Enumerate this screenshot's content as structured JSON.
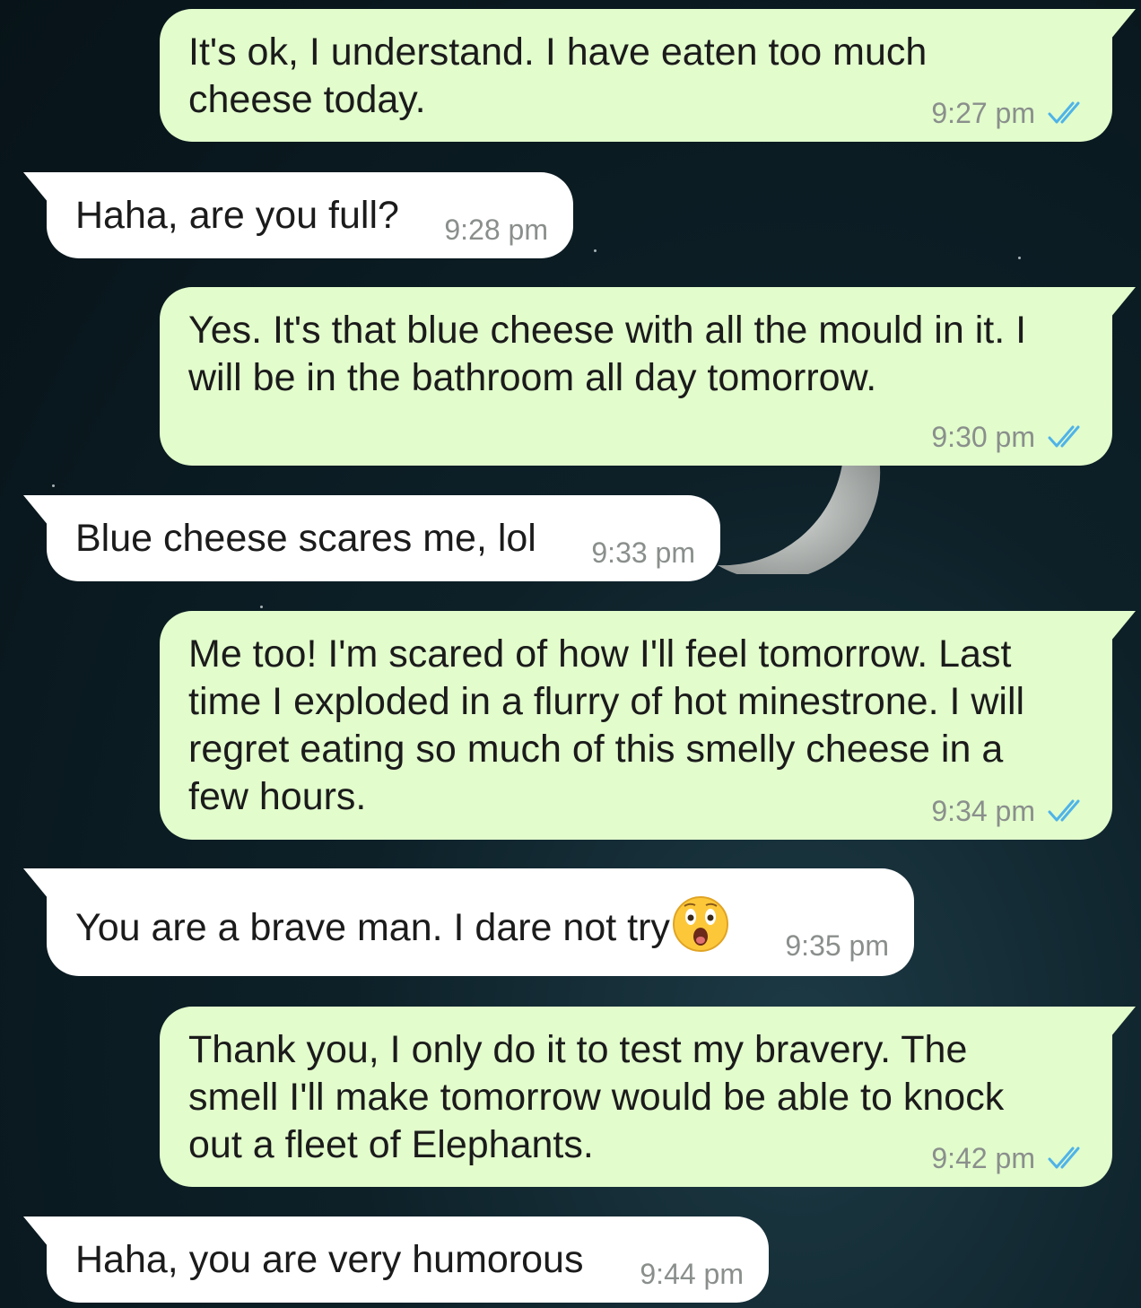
{
  "colors": {
    "outgoing_bubble": "#e2fccc",
    "incoming_bubble": "#ffffff",
    "read_receipt": "#4fb3e8",
    "timestamp": "#8a8f8c",
    "background": "#0d2028"
  },
  "messages": [
    {
      "direction": "out",
      "text": "It's ok, I understand. I have eaten too much\ncheese today.",
      "time": "9:27 pm",
      "status": "read-double-check-icon"
    },
    {
      "direction": "in",
      "text": "Haha, are you full?",
      "time": "9:28 pm"
    },
    {
      "direction": "out",
      "text": "Yes. It's that blue cheese with all the mould in it. I\nwill be in the bathroom all day tomorrow.",
      "time": "9:30 pm",
      "status": "read-double-check-icon"
    },
    {
      "direction": "in",
      "text": "Blue cheese scares me, lol",
      "time": "9:33 pm"
    },
    {
      "direction": "out",
      "text": "Me too! I'm scared of how I'll feel tomorrow. Last\ntime I exploded in a flurry of hot minestrone. I will\nregret eating so much of this smelly cheese in a\nfew hours.",
      "time": "9:34 pm",
      "status": "read-double-check-icon"
    },
    {
      "direction": "in",
      "text": "You are a brave man. I dare not try",
      "time": "9:35 pm",
      "emoji": "astonished-face-icon"
    },
    {
      "direction": "out",
      "text": "Thank you, I only do it to test my bravery. The\nsmell I'll make tomorrow would be able to knock\nout a fleet of Elephants.",
      "time": "9:42 pm",
      "status": "read-double-check-icon"
    },
    {
      "direction": "in",
      "text": "Haha, you are very humorous",
      "time": "9:44 pm"
    }
  ]
}
